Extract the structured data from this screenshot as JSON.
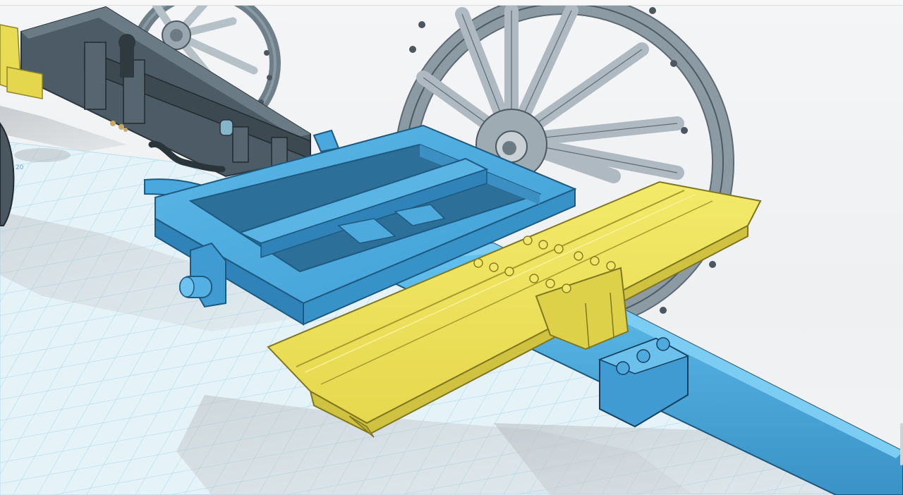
{
  "viewport": {
    "name": "3d-model-viewport",
    "grid_tick_label": "20"
  },
  "colors": {
    "background": "#f1f2f3",
    "grid_fill": "#e3f1f8",
    "grid_line": "#9fd3ea",
    "selected_blue": "#4aa8de",
    "selected_blue_dark": "#2f7fb0",
    "highlight_yellow": "#ede25a",
    "highlight_yellow_dark": "#c9bd3a",
    "metal_gray": "#5f6f7a",
    "metal_dark": "#3d4a53",
    "wheel_gray": "#a9b5bd"
  },
  "parts": [
    {
      "name": "artillery-wheel-right",
      "state": "unselected"
    },
    {
      "name": "artillery-wheel-left",
      "state": "unselected"
    },
    {
      "name": "gun-carriage-trail",
      "state": "unselected"
    },
    {
      "name": "limber-frame",
      "state": "selected-blue"
    },
    {
      "name": "limber-pole",
      "state": "selected-blue"
    },
    {
      "name": "limber-seat-board",
      "state": "highlighted-yellow"
    },
    {
      "name": "trail-end-block",
      "state": "highlighted-yellow"
    }
  ]
}
